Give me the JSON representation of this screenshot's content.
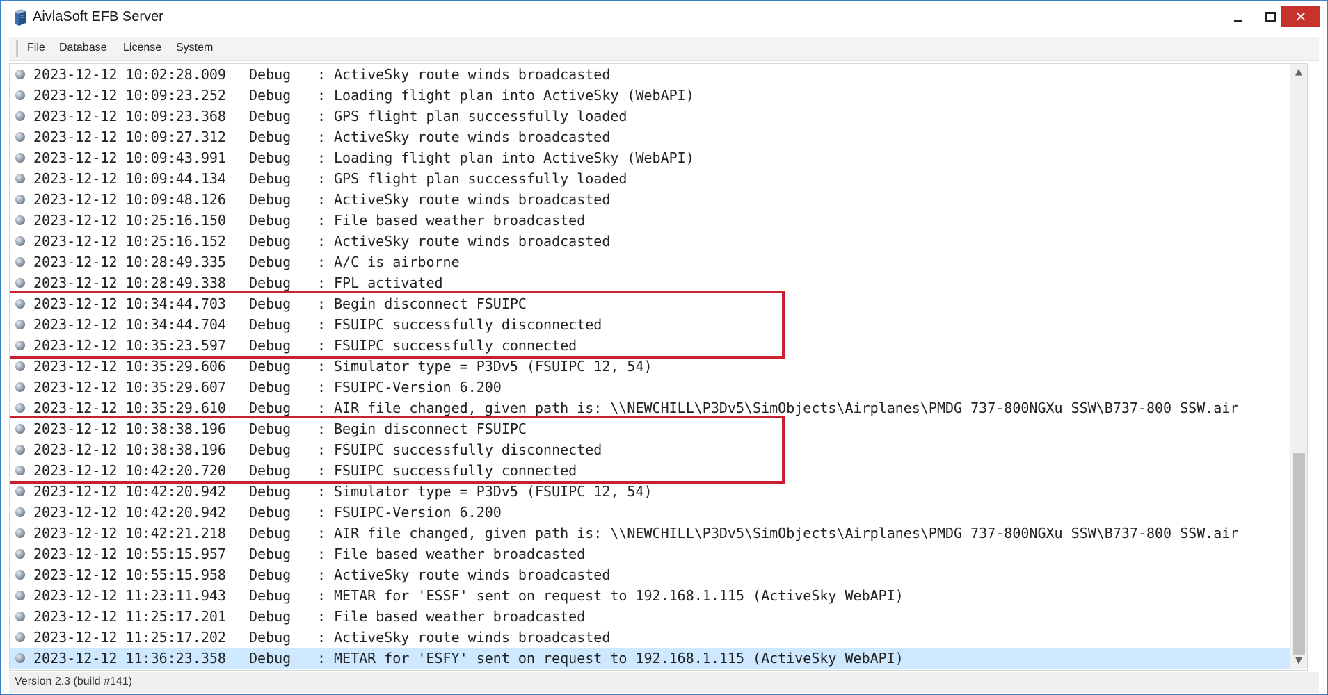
{
  "window": {
    "title": "AivlaSoft EFB Server",
    "app_icon": "server-icon",
    "controls": [
      "minimize-icon",
      "maximize-icon",
      "close-icon"
    ]
  },
  "menu": [
    {
      "label": "File"
    },
    {
      "label": "Database"
    },
    {
      "label": "License"
    },
    {
      "label": "System"
    }
  ],
  "log": {
    "separator": ":",
    "entries": [
      {
        "timestamp": "2023-12-12 10:02:28.009",
        "level": "Debug",
        "message": "ActiveSky route winds broadcasted"
      },
      {
        "timestamp": "2023-12-12 10:09:23.252",
        "level": "Debug",
        "message": "Loading flight plan into ActiveSky (WebAPI)"
      },
      {
        "timestamp": "2023-12-12 10:09:23.368",
        "level": "Debug",
        "message": "GPS flight plan successfully loaded"
      },
      {
        "timestamp": "2023-12-12 10:09:27.312",
        "level": "Debug",
        "message": "ActiveSky route winds broadcasted"
      },
      {
        "timestamp": "2023-12-12 10:09:43.991",
        "level": "Debug",
        "message": "Loading flight plan into ActiveSky (WebAPI)"
      },
      {
        "timestamp": "2023-12-12 10:09:44.134",
        "level": "Debug",
        "message": "GPS flight plan successfully loaded"
      },
      {
        "timestamp": "2023-12-12 10:09:48.126",
        "level": "Debug",
        "message": "ActiveSky route winds broadcasted"
      },
      {
        "timestamp": "2023-12-12 10:25:16.150",
        "level": "Debug",
        "message": "File based weather broadcasted"
      },
      {
        "timestamp": "2023-12-12 10:25:16.152",
        "level": "Debug",
        "message": "ActiveSky route winds broadcasted"
      },
      {
        "timestamp": "2023-12-12 10:28:49.335",
        "level": "Debug",
        "message": "A/C is airborne"
      },
      {
        "timestamp": "2023-12-12 10:28:49.338",
        "level": "Debug",
        "message": "FPL activated"
      },
      {
        "timestamp": "2023-12-12 10:34:44.703",
        "level": "Debug",
        "message": "Begin disconnect FSUIPC"
      },
      {
        "timestamp": "2023-12-12 10:34:44.704",
        "level": "Debug",
        "message": "FSUIPC successfully disconnected"
      },
      {
        "timestamp": "2023-12-12 10:35:23.597",
        "level": "Debug",
        "message": "FSUIPC successfully connected"
      },
      {
        "timestamp": "2023-12-12 10:35:29.606",
        "level": "Debug",
        "message": "Simulator type = P3Dv5 (FSUIPC 12, 54)"
      },
      {
        "timestamp": "2023-12-12 10:35:29.607",
        "level": "Debug",
        "message": "FSUIPC-Version 6.200"
      },
      {
        "timestamp": "2023-12-12 10:35:29.610",
        "level": "Debug",
        "message": "AIR file changed, given path is: \\\\NEWCHILL\\P3Dv5\\SimObjects\\Airplanes\\PMDG 737-800NGXu SSW\\B737-800 SSW.air"
      },
      {
        "timestamp": "2023-12-12 10:38:38.196",
        "level": "Debug",
        "message": "Begin disconnect FSUIPC"
      },
      {
        "timestamp": "2023-12-12 10:38:38.196",
        "level": "Debug",
        "message": "FSUIPC successfully disconnected"
      },
      {
        "timestamp": "2023-12-12 10:42:20.720",
        "level": "Debug",
        "message": "FSUIPC successfully connected"
      },
      {
        "timestamp": "2023-12-12 10:42:20.942",
        "level": "Debug",
        "message": "Simulator type = P3Dv5 (FSUIPC 12, 54)"
      },
      {
        "timestamp": "2023-12-12 10:42:20.942",
        "level": "Debug",
        "message": "FSUIPC-Version 6.200"
      },
      {
        "timestamp": "2023-12-12 10:42:21.218",
        "level": "Debug",
        "message": "AIR file changed, given path is: \\\\NEWCHILL\\P3Dv5\\SimObjects\\Airplanes\\PMDG 737-800NGXu SSW\\B737-800 SSW.air"
      },
      {
        "timestamp": "2023-12-12 10:55:15.957",
        "level": "Debug",
        "message": "File based weather broadcasted"
      },
      {
        "timestamp": "2023-12-12 10:55:15.958",
        "level": "Debug",
        "message": "ActiveSky route winds broadcasted"
      },
      {
        "timestamp": "2023-12-12 11:23:11.943",
        "level": "Debug",
        "message": "METAR for 'ESSF' sent on request to 192.168.1.115 (ActiveSky WebAPI)"
      },
      {
        "timestamp": "2023-12-12 11:25:17.201",
        "level": "Debug",
        "message": "File based weather broadcasted"
      },
      {
        "timestamp": "2023-12-12 11:25:17.202",
        "level": "Debug",
        "message": "ActiveSky route winds broadcasted"
      },
      {
        "timestamp": "2023-12-12 11:36:23.358",
        "level": "Debug",
        "message": "METAR for 'ESFY' sent on request to 192.168.1.115 (ActiveSky WebAPI)",
        "selected": true
      }
    ],
    "highlight_groups": [
      {
        "from_row": 11,
        "to_row": 13
      },
      {
        "from_row": 17,
        "to_row": 19
      }
    ],
    "highlight_color": "#c8202f",
    "selected_row_color": "#cde8ff"
  },
  "status": {
    "version": "Version 2.3 (build #141)"
  }
}
